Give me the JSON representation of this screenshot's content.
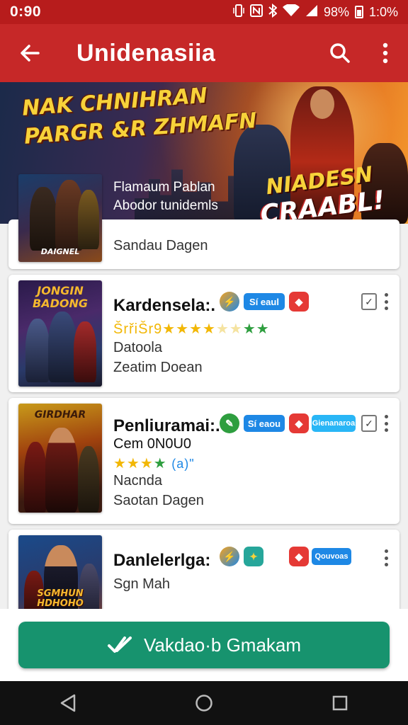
{
  "status_bar": {
    "time": "0:90",
    "battery": "98%",
    "extra": "1:0%"
  },
  "app_bar": {
    "title": "Unidenasiia"
  },
  "banner": {
    "headline_line1": "NAK CHNIHRAN",
    "headline_line2": "PARGR &R ZHMAFN",
    "promo_line1": "NIADESN",
    "promo_line2": "CRAABL!"
  },
  "games": [
    {
      "title": "Flamaum Pablan",
      "subtitle": "Abodor tunidemls",
      "meta": "Sandau Dagen",
      "cover_caption": "DAIGNEL"
    },
    {
      "title": "Kardensela:.",
      "stars": "★★★★",
      "stars_prefix": "ŠrřiŠr9",
      "stars_suffix": "★★",
      "genre": "Datoola",
      "meta": "Zeatim Doean",
      "chips": [
        "Sí eaul"
      ],
      "cover_caption": "JONGIN\nBADONG"
    },
    {
      "title": "Penliuramai:.",
      "subtitle": "Cem 0N0U0",
      "stars": "★★★",
      "stars_green": "★",
      "rating": "(a)\"",
      "genre": "Nacnda",
      "meta": "Saotan Dagen",
      "chips": [
        "Sí eaou",
        "Gienanaroa"
      ],
      "cover_caption": "GIRDHAR"
    },
    {
      "title": "Danlelerlga:",
      "subtitle": "Sgn Mah",
      "chips": [
        "Qouvoas"
      ],
      "cover_caption": "SGMHUN\nHDHOHO"
    }
  ],
  "cta": {
    "label": "Vakdao·b Gmakam"
  },
  "colors": {
    "status_bar": "#b71c1c",
    "app_bar": "#c62828",
    "cta": "#17936e",
    "chip_blue": "#1e88e5",
    "chip_red": "#e53935"
  },
  "icons": [
    "back-arrow-icon",
    "search-icon",
    "more-vert-icon",
    "check-icon",
    "nav-back-icon",
    "nav-home-icon",
    "nav-recents-icon"
  ]
}
